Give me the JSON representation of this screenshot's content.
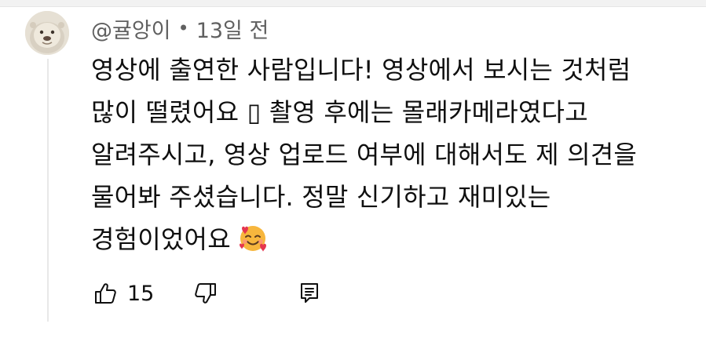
{
  "comment": {
    "author": "@귤앙이",
    "separator": "•",
    "time": "13일 전",
    "lines": [
      "영상에 출연한 사람입니다! 영상에서 보시는 것처럼",
      "많이 떨렸어요 ▯ 촬영 후에는 몰래카메라였다고",
      "알려주시고, 영상 업로드 여부에 대해서도 제 의견을",
      "물어봐 주셨습니다. 정말 신기하고 재미있는",
      "경험이었어요"
    ],
    "emoji": "smiling-face-with-hearts-emoji"
  },
  "actions": {
    "like_count": "15",
    "like_icon": "thumbs-up-icon",
    "dislike_icon": "thumbs-down-icon",
    "reply_icon": "reply-icon"
  },
  "colors": {
    "text": "#0f0f0f",
    "meta": "#606060",
    "thread_line": "#e8e8e8",
    "emoji_face": "#f7b63d",
    "emoji_heart": "#e5364f"
  }
}
